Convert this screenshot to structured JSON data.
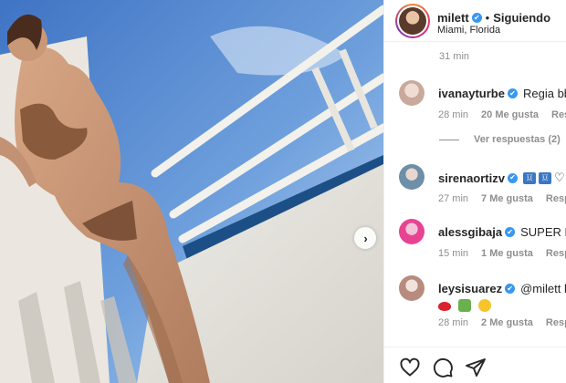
{
  "post": {
    "header": {
      "username": "milett",
      "separator": "•",
      "follow_status": "Siguiendo",
      "location": "Miami, Florida",
      "verified_icon": "✔"
    },
    "first_time": "31 min",
    "comments": [
      {
        "username": "ivanayturbe",
        "text": "Regia bb",
        "time": "28 min",
        "likes": "20 Me gusta",
        "reply": "Respo",
        "avatar_color": "#d9c7c0",
        "extra_icon": "heart-icon",
        "view_replies": "Ver respuestas (2)"
      },
      {
        "username": "sirenaortizv",
        "text": "",
        "time": "27 min",
        "likes": "7 Me gusta",
        "reply": "Respo",
        "avatar_color": "#b9d2e3",
        "emoji_flags": [
          "🇺",
          "🇺"
        ]
      },
      {
        "username": "alessgibaja",
        "text": "SUPER BOD",
        "time": "15 min",
        "likes": "1 Me gusta",
        "reply": "Respo",
        "avatar_color": "#e84393"
      },
      {
        "username": "leysisuarez",
        "text": "@milett bo",
        "time": "28 min",
        "likes": "2 Me gusta",
        "reply": "Respo",
        "avatar_color": "#d8b7ad",
        "emojis": [
          "lips",
          "green",
          "face"
        ]
      }
    ],
    "icons": {
      "like": "heart-icon",
      "comment": "comment-icon",
      "share": "paper-plane-icon",
      "next": "chevron-right-icon"
    },
    "next_glyph": "›",
    "colors": {
      "verified": "#3897f0",
      "secondary_text": "#8e8e8e",
      "border": "#efefef"
    }
  }
}
